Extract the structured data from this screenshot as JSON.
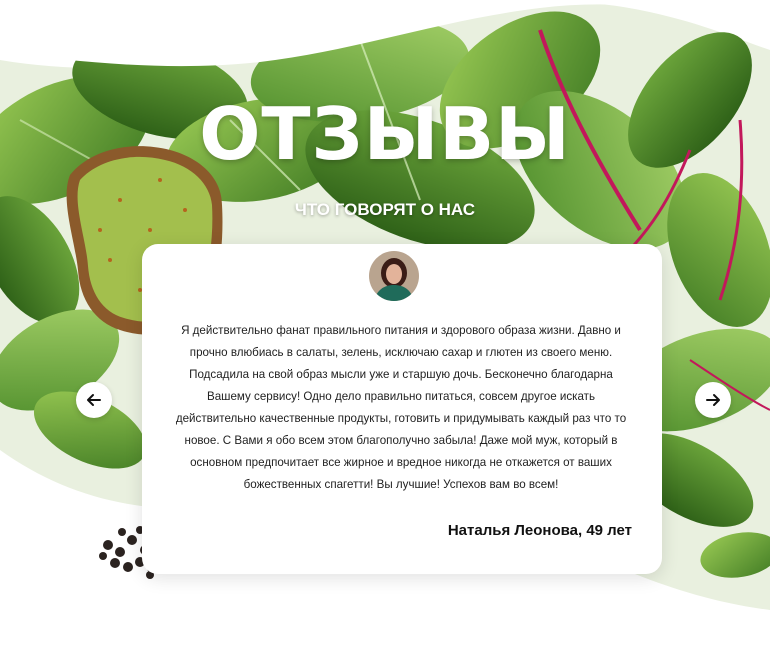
{
  "section": {
    "title": "ОТЗЫВЫ",
    "subtitle": "ЧТО ГОВОРЯТ О НАС"
  },
  "review": {
    "text": "Я действительно фанат правильного питания и здорового образа жизни. Давно и прочно влюбиась в салаты, зелень, исключаю сахар и глютен из своего меню. Подсадила на свой образ мысли уже и старшую дочь. Бесконечно благодарна Вашему сервису!  Одно дело правильно питаться, совсем другое искать действительно качественные продукты, готовить и придумывать каждый раз что то новое. С Вами я обо всем этом благополучно забыла! Даже мой муж, который в основном предпочитает все жирное и вредное никогда не откажется от ваших божественных спагетти! Вы лучшие! Успехов вам во всем!",
    "author": "Наталья Леонова, 49 лет"
  },
  "icons": {
    "prev": "arrow-left-icon",
    "next": "arrow-right-icon"
  },
  "colors": {
    "leaf_dark": "#3f7a23",
    "leaf_light": "#7bb43c",
    "stem": "#c2185b",
    "avocado": "#a3bf4d",
    "toast": "#8b5a2b"
  }
}
